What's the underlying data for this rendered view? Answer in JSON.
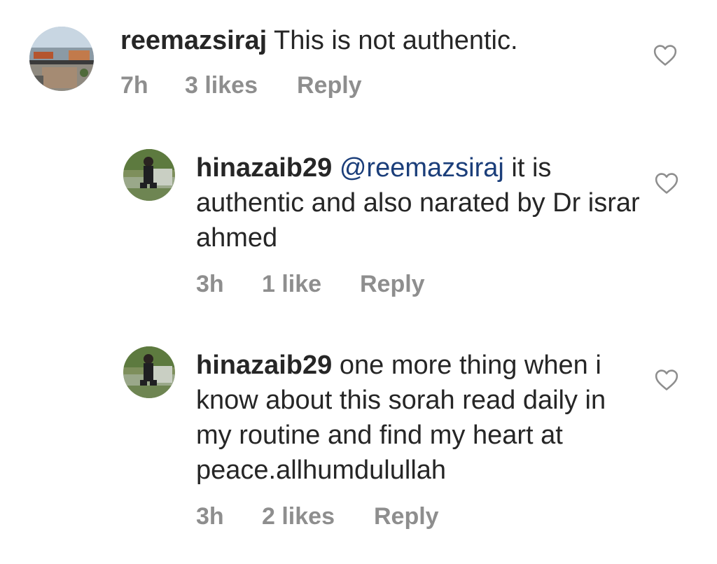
{
  "comments": [
    {
      "username": "reemazsiraj",
      "mention": "",
      "text": "This is not authentic.",
      "time": "7h",
      "likes": "3 likes",
      "reply_label": "Reply"
    }
  ],
  "replies": [
    {
      "username": "hinazaib29",
      "mention": "@reemazsiraj",
      "text": " it is authentic and also narated by Dr israr ahmed",
      "time": "3h",
      "likes": "1 like",
      "reply_label": "Reply"
    },
    {
      "username": "hinazaib29",
      "mention": "",
      "text": "one more thing when i know about this sorah read daily in my routine and find my heart at peace.allhumdulullah",
      "time": "3h",
      "likes": "2 likes",
      "reply_label": "Reply"
    }
  ],
  "icons": {
    "like": "heart-outline-icon"
  },
  "colors": {
    "text": "#262626",
    "meta": "#8e8e8e",
    "mention": "#1b3e7a"
  }
}
